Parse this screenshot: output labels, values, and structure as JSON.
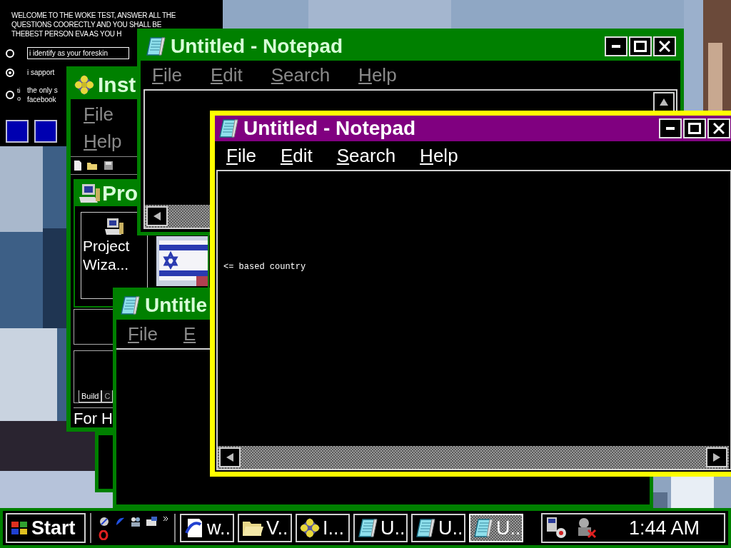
{
  "quiz": {
    "heading": [
      "WELCOME TO THE WOKE TEST, ANSWER ALL THE",
      "QUESTIONS COORECTLY AND YOU SHALL BE",
      "THEBEST PERSON EVA AS YOU H"
    ],
    "options": [
      {
        "kind": "field",
        "selected": false,
        "lines": [
          "i identify as your foreskin"
        ]
      },
      {
        "kind": "text",
        "selected": true,
        "lines": [
          "i sapport"
        ]
      },
      {
        "kind": "text",
        "selected": false,
        "marker": [
          "ti",
          "o"
        ],
        "lines": [
          "the only s",
          "facebook"
        ]
      }
    ]
  },
  "install_window": {
    "title": "Inst",
    "active": false,
    "menu": [
      "File",
      "Help"
    ],
    "project_window": {
      "title": "Pro",
      "item": "Project Wiza..."
    },
    "tabs": [
      {
        "label": "Build",
        "selected": true
      },
      {
        "label": "C",
        "selected": false
      }
    ],
    "status": "For H"
  },
  "windows": [
    {
      "title": "Untitled - Notepad",
      "active": false,
      "menu": [
        "File",
        "Edit",
        "Search",
        "Help"
      ]
    },
    {
      "title": "Untitle",
      "active": false,
      "menu": [
        "File",
        "E"
      ]
    },
    {
      "title": "Untitled - Notepad",
      "active": true,
      "menu": [
        "File",
        "Edit",
        "Search",
        "Help"
      ],
      "text": "<= based country"
    }
  ],
  "taskbar": {
    "start": "Start",
    "tasks": [
      {
        "label": "w..",
        "selected": false
      },
      {
        "label": "V..",
        "selected": false
      },
      {
        "label": "I...",
        "selected": false
      },
      {
        "label": "U..",
        "selected": false
      },
      {
        "label": "U..",
        "selected": false
      },
      {
        "label": "U..",
        "selected": true
      }
    ],
    "clock": "1:44 AM"
  }
}
